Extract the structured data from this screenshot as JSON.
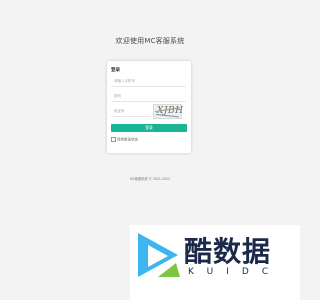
{
  "page": {
    "title": "欢迎使用MC客服系统"
  },
  "login": {
    "heading": "登录",
    "username_placeholder": "请输入手机号",
    "password_placeholder": "密码",
    "captcha_placeholder": "验证码",
    "captcha_text": "XJBH",
    "submit_label": "登录",
    "remember_label": "保持登录状态"
  },
  "footer": {
    "copyright": "MC客服系统 © 2021-2022"
  },
  "watermark": {
    "brand": "酷数据",
    "sub": "KUIDC",
    "icon": "play-logo-icon"
  },
  "colors": {
    "background": "#f3f3f4",
    "primary": "#1ab394",
    "watermark_text": "#1b2a4a"
  }
}
